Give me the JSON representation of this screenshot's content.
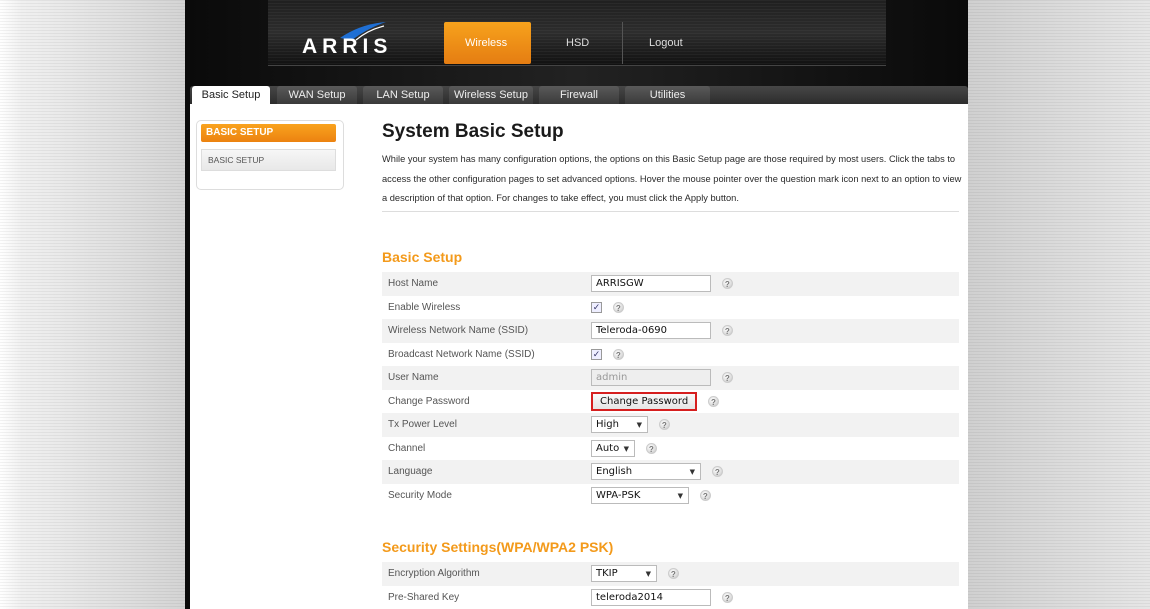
{
  "header": {
    "logo": "ARRIS",
    "nav": [
      {
        "label": "Wireless",
        "active": true
      },
      {
        "label": "HSD",
        "active": false
      },
      {
        "label": "Logout",
        "active": false
      }
    ]
  },
  "tabs": [
    {
      "label": "Basic Setup",
      "active": true
    },
    {
      "label": "WAN Setup"
    },
    {
      "label": "LAN Setup"
    },
    {
      "label": "Wireless Setup"
    },
    {
      "label": "Firewall"
    },
    {
      "label": "Utilities"
    }
  ],
  "sidebar": {
    "heading": "BASIC SETUP",
    "items": [
      {
        "label": "BASIC SETUP"
      }
    ]
  },
  "main": {
    "title": "System Basic Setup",
    "intro": "While your system has many configuration options, the options on this Basic Setup page are those required by most users. Click the tabs to access the other configuration pages to set advanced options. Hover the mouse pointer over the question mark icon next to an option to view a description of that option. For changes to take effect, you must click the Apply button."
  },
  "basic_setup": {
    "title": "Basic Setup",
    "rows": [
      {
        "label": "Host Name",
        "type": "text",
        "value": "ARRISGW"
      },
      {
        "label": "Enable Wireless",
        "type": "checkbox",
        "checked": true
      },
      {
        "label": "Wireless Network Name (SSID)",
        "type": "text",
        "value": "Teleroda-0690"
      },
      {
        "label": "Broadcast Network Name (SSID)",
        "type": "checkbox",
        "checked": true
      },
      {
        "label": "User Name",
        "type": "text-disabled",
        "value": "admin"
      },
      {
        "label": "Change Password",
        "type": "button",
        "value": "Change Password"
      },
      {
        "label": "Tx Power Level",
        "type": "select",
        "value": "High"
      },
      {
        "label": "Channel",
        "type": "select",
        "value": "Auto"
      },
      {
        "label": "Language",
        "type": "select",
        "value": "English"
      },
      {
        "label": "Security Mode",
        "type": "select",
        "value": "WPA-PSK"
      }
    ]
  },
  "security": {
    "title": "Security Settings(WPA/WPA2 PSK)",
    "rows": [
      {
        "label": "Encryption Algorithm",
        "type": "select",
        "value": "TKIP"
      },
      {
        "label": "Pre-Shared Key",
        "type": "text",
        "value": "teleroda2014"
      }
    ]
  },
  "icons": {
    "help": "question-mark-icon",
    "checkbox": "checkmark-icon",
    "dropdown": "chevron-down-icon"
  },
  "colors": {
    "accent": "#f39a1b",
    "highlight_border": "#d61f1f"
  }
}
